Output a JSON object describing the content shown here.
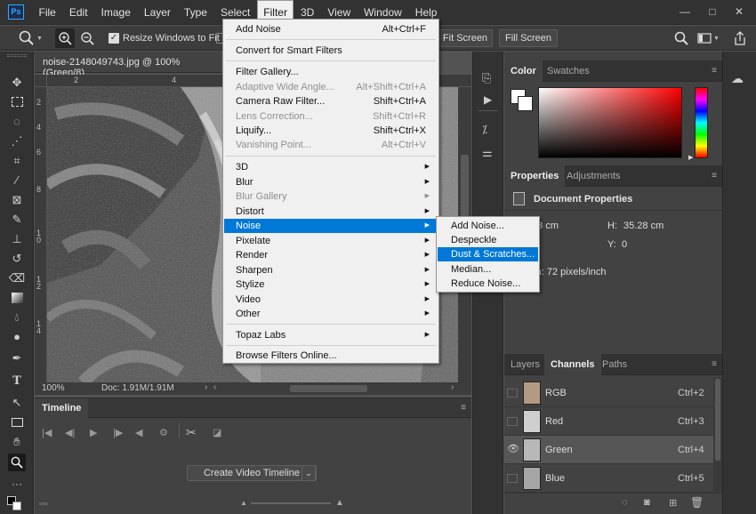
{
  "app": {
    "logo": "Ps"
  },
  "menubar": {
    "items": [
      "File",
      "Edit",
      "Image",
      "Layer",
      "Type",
      "Select",
      "Filter",
      "3D",
      "View",
      "Window",
      "Help"
    ],
    "active": "Filter"
  },
  "window_controls": {
    "minimize": "—",
    "maximize": "□",
    "close": "✕"
  },
  "options": {
    "resize_windows": {
      "label": "Resize Windows to Fit",
      "checked": true
    },
    "fit_screen": "Fit Screen",
    "fill_screen": "Fill Screen"
  },
  "document": {
    "tab_title": "noise-2148049743.jpg @ 100% (Green/8)",
    "zoom": "100%",
    "doc_size": "Doc: 1.91M/1.91M",
    "ruler_top": [
      "2",
      "4"
    ],
    "ruler_left": [
      "2",
      "4",
      "6",
      "8",
      "1 0",
      "1 2",
      "1 4"
    ]
  },
  "filter_menu": {
    "items": [
      {
        "label": "Add Noise",
        "shortcut": "Alt+Ctrl+F",
        "disabled": false
      },
      {
        "label": "Convert for Smart Filters",
        "shortcut": "",
        "disabled": false
      },
      {
        "label": "Filter Gallery...",
        "shortcut": "",
        "disabled": false
      },
      {
        "label": "Adaptive Wide Angle...",
        "shortcut": "Alt+Shift+Ctrl+A",
        "disabled": true
      },
      {
        "label": "Camera Raw Filter...",
        "shortcut": "Shift+Ctrl+A",
        "disabled": false
      },
      {
        "label": "Lens Correction...",
        "shortcut": "Shift+Ctrl+R",
        "disabled": true
      },
      {
        "label": "Liquify...",
        "shortcut": "Shift+Ctrl+X",
        "disabled": false
      },
      {
        "label": "Vanishing Point...",
        "shortcut": "Alt+Ctrl+V",
        "disabled": true
      },
      {
        "label": "3D",
        "submenu": true,
        "disabled": false
      },
      {
        "label": "Blur",
        "submenu": true,
        "disabled": false
      },
      {
        "label": "Blur Gallery",
        "submenu": true,
        "disabled": true
      },
      {
        "label": "Distort",
        "submenu": true,
        "disabled": false
      },
      {
        "label": "Noise",
        "submenu": true,
        "disabled": false,
        "highlighted": true
      },
      {
        "label": "Pixelate",
        "submenu": true,
        "disabled": false
      },
      {
        "label": "Render",
        "submenu": true,
        "disabled": false
      },
      {
        "label": "Sharpen",
        "submenu": true,
        "disabled": false
      },
      {
        "label": "Stylize",
        "submenu": true,
        "disabled": false
      },
      {
        "label": "Video",
        "submenu": true,
        "disabled": false
      },
      {
        "label": "Other",
        "submenu": true,
        "disabled": false
      },
      {
        "label": "Topaz Labs",
        "submenu": true,
        "disabled": false
      },
      {
        "label": "Browse Filters Online...",
        "shortcut": "",
        "disabled": false
      }
    ]
  },
  "noise_submenu": {
    "items": [
      "Add Noise...",
      "Despeckle",
      "Dust & Scratches...",
      "Median...",
      "Reduce Noise..."
    ],
    "highlighted": "Dust & Scratches..."
  },
  "timeline": {
    "tab": "Timeline",
    "create_button": "Create Video Timeline"
  },
  "color_panel": {
    "tabs": [
      "Color",
      "Swatches"
    ],
    "active": "Color",
    "foreground": "#ffffff",
    "background": "#ffffff"
  },
  "properties_panel": {
    "tabs": [
      "Properties",
      "Adjustments"
    ],
    "active": "Properties",
    "title": "Document Properties",
    "w_value": ".53 cm",
    "h_label": "H:",
    "h_value": "35.28 cm",
    "y_label": "Y:",
    "y_value": "0",
    "resolution": "tion: 72 pixels/inch"
  },
  "channels_panel": {
    "tabs": [
      "Layers",
      "Channels",
      "Paths"
    ],
    "active": "Channels",
    "rows": [
      {
        "name": "RGB",
        "shortcut": "Ctrl+2",
        "visible": false,
        "selected": false
      },
      {
        "name": "Red",
        "shortcut": "Ctrl+3",
        "visible": false,
        "selected": false
      },
      {
        "name": "Green",
        "shortcut": "Ctrl+4",
        "visible": true,
        "selected": true
      },
      {
        "name": "Blue",
        "shortcut": "Ctrl+5",
        "visible": false,
        "selected": false
      }
    ]
  }
}
